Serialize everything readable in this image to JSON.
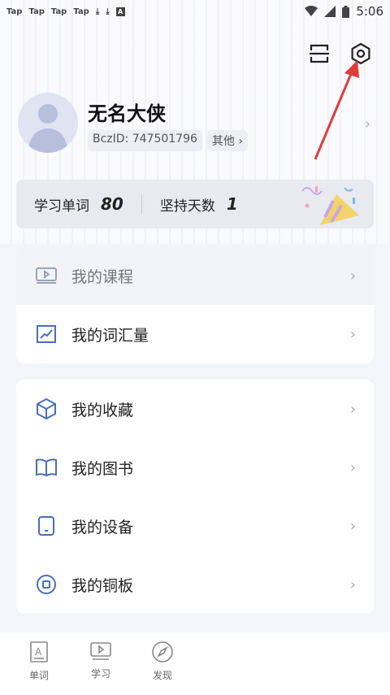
{
  "status_bar": {
    "left_items": [
      "Tap",
      "Tap",
      "Tap",
      "Tap"
    ],
    "time": "5:06"
  },
  "profile": {
    "nickname": "无名大侠",
    "bcz_id": "BczID: 747501796",
    "other_tag": "其他 ›"
  },
  "stats": {
    "words_label": "学习单词",
    "words_value": "80",
    "days_label": "坚持天数",
    "days_value": "1"
  },
  "menu_group1": [
    {
      "label": "我的课程",
      "icon": "video-lesson-icon"
    },
    {
      "label": "我的词汇量",
      "icon": "trend-chart-icon"
    }
  ],
  "menu_group2": [
    {
      "label": "我的收藏",
      "icon": "box-icon"
    },
    {
      "label": "我的图书",
      "icon": "book-icon"
    },
    {
      "label": "我的设备",
      "icon": "device-icon"
    },
    {
      "label": "我的铜板",
      "icon": "coin-icon"
    }
  ],
  "tabs": [
    {
      "label": "单词",
      "icon": "word-icon"
    },
    {
      "label": "学习",
      "icon": "study-icon"
    },
    {
      "label": "发现",
      "icon": "compass-icon"
    }
  ],
  "colors": {
    "accent_blue": "#4a6fb5",
    "arrow_red": "#e23b3b"
  }
}
